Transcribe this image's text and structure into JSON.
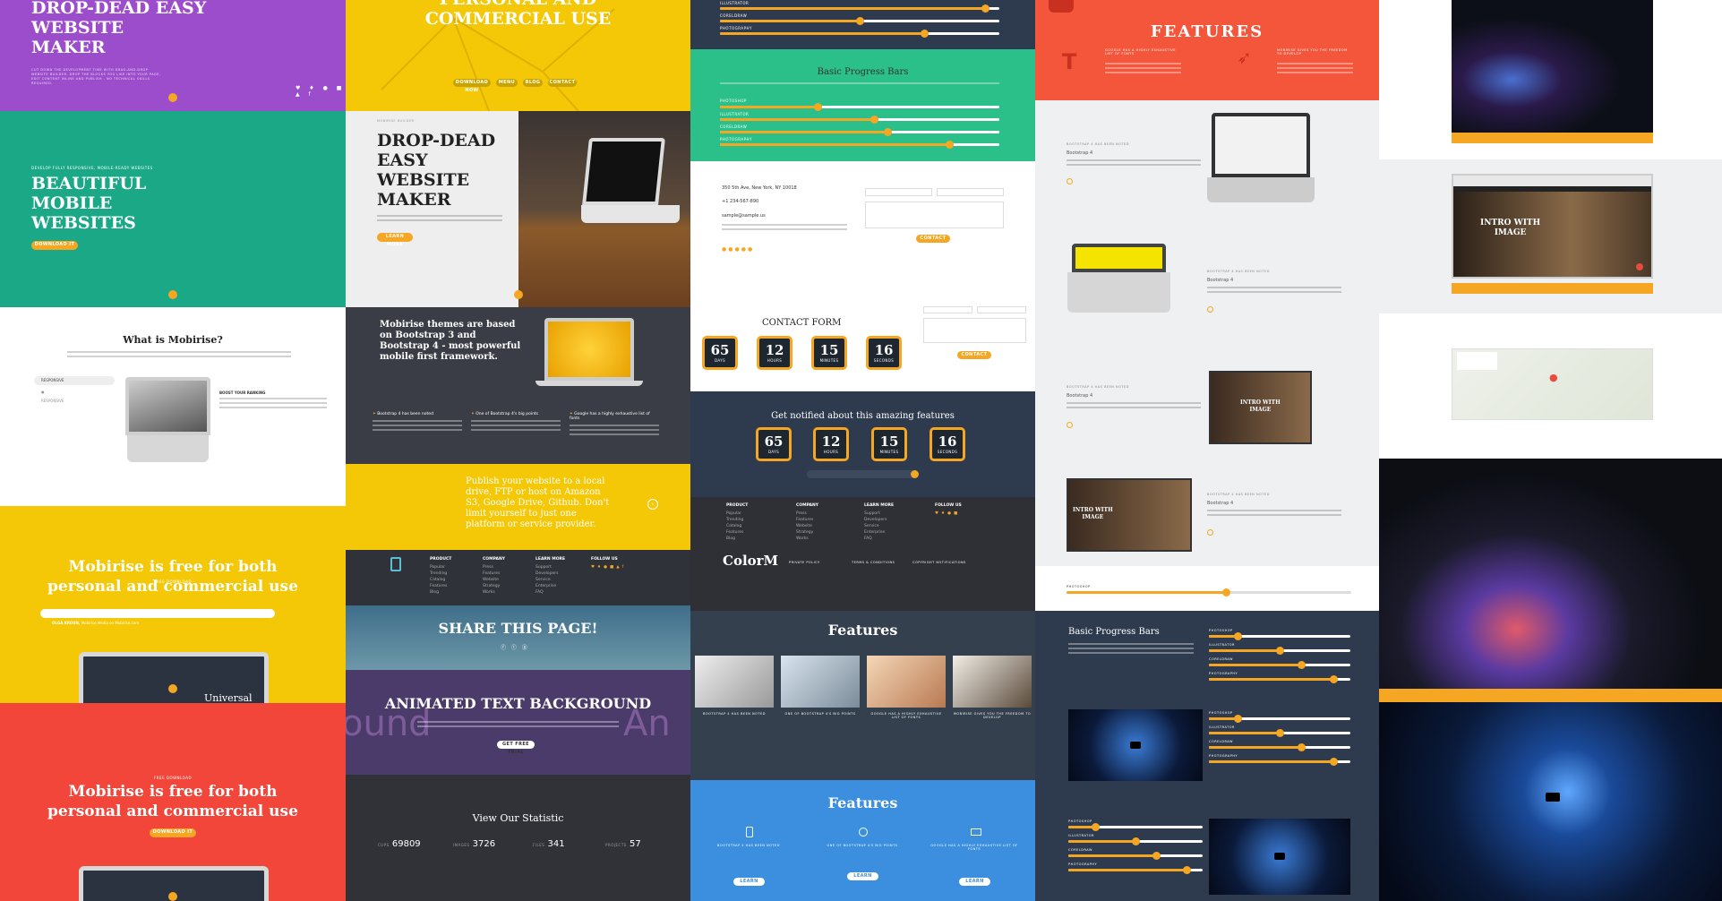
{
  "colors": {
    "accent": "#f5a623",
    "purple": "#9c4dcc",
    "teal": "#1aa886",
    "yellow": "#f4c807",
    "red": "#f2463a",
    "navy": "#2e3b4e",
    "darkgrey": "#3a3d45",
    "green": "#2bbf8a",
    "blue": "#3b8fde",
    "orange": "#f4563b",
    "lightgrey": "#eff0f2"
  },
  "c1": {
    "hero_title": "DROP-DEAD EASY\nWEBSITE\nMAKER",
    "hero_sub": "CUT DOWN THE DEVELOPMENT TIME WITH DRAG-AND-DROP WEBSITE BUILDER. DROP THE BLOCKS YOU LIKE INTO YOUR PAGE, EDIT CONTENT INLINE AND PUBLISH - NO TECHNICAL SKILLS REQUIRED.",
    "teal_kicker": "DEVELOP FULLY RESPONSIVE, MOBILE-READY WEBSITES",
    "teal_title": "BEAUTIFUL\nMOBILE\nWEBSITES",
    "teal_btn": "DOWNLOAD IT",
    "what_title": "What is Mobirise?",
    "tabs": [
      "RESPONSIVE",
      "",
      "RESPONSIVE"
    ],
    "boost": "BOOST YOUR RANKING",
    "free_kicker": "FREE DOWNLOAD",
    "free_title": "Mobirise is free for both\npersonal and commercial use",
    "testimonial_name": "OLGA KROUN,",
    "testimonial_role": "Mobirise Media on Mobirise.com",
    "universal": "Universal",
    "free_kicker2": "FREE DOWNLOAD",
    "free_title2": "Mobirise is free for both\npersonal and commercial use",
    "free_btn2": "DOWNLOAD IT"
  },
  "c2": {
    "top_title": "PERSONAL AND\nCOMMERCIAL USE",
    "top_btns": [
      "DOWNLOAD NOW",
      "MENU",
      "BLOG",
      "CONTACT"
    ],
    "hero_kicker": "MOBIRISE BUILDER",
    "hero_title": "DROP-DEAD\nEASY\nWEBSITE\nMAKER",
    "hero_btn": "LEARN MORE",
    "themes_title": "Mobirise themes are based\non Bootstrap 3 and\nBootstrap 4 - most powerful\nmobile first framework.",
    "feat": [
      "Bootstrap 4 has been noted",
      "One of Bootstrap 4's big points",
      "Google has a highly exhaustive list of fonts"
    ],
    "publish": "Publish your website to a local\ndrive, FTP or host on Amazon\nS3, Google Drive, Github. Don't\nlimit yourself to just one\nplatform or service provider.",
    "foot_cols": [
      {
        "h": "PRODUCT",
        "items": [
          "Popular",
          "Trending",
          "Catalog",
          "Features",
          "Blog"
        ]
      },
      {
        "h": "COMPANY",
        "items": [
          "Press",
          "Features",
          "Website",
          "Strategy",
          "Works"
        ]
      },
      {
        "h": "LEARN MORE",
        "items": [
          "Support",
          "Developers",
          "Service",
          "Enterprise",
          "FAQ"
        ]
      },
      {
        "h": "FOLLOW US",
        "items": []
      }
    ],
    "share": "SHARE THIS PAGE!",
    "animated": "ANIMATED TEXT BACKGROUND",
    "animated_bg_left": "ound",
    "animated_bg_right": "An",
    "animated_btn": "GET FREE TRIAL",
    "stats_title": "View Our Statistic",
    "stats": [
      {
        "label": "CUPS",
        "value": "69809"
      },
      {
        "label": "IMAGES",
        "value": "3726"
      },
      {
        "label": "FILES",
        "value": "341"
      },
      {
        "label": "PROJECTS",
        "value": "57"
      }
    ]
  },
  "c3": {
    "bars_labels": [
      "ILLUSTRATOR",
      "CORELDRAW",
      "PHOTOGRAPHY"
    ],
    "bars_values": [
      0.95,
      0.5,
      0.73
    ],
    "basic_title": "Basic Progress Bars",
    "green_labels": [
      "PHOTOSHOP",
      "ILLUSTRATOR",
      "CORELDRAW",
      "PHOTOGRAPHY"
    ],
    "green_values": [
      0.35,
      0.55,
      0.6,
      0.82
    ],
    "address": "350 5th Ave, New York, NY 10018",
    "phone": "+1 234-567-890",
    "email": "sample@sample.us",
    "contact_btn": "CONTACT US",
    "form_title": "CONTACT FORM",
    "countdown": [
      {
        "v": "65",
        "l": "DAYS"
      },
      {
        "v": "12",
        "l": "HOURS"
      },
      {
        "v": "15",
        "l": "MINUTES"
      },
      {
        "v": "16",
        "l": "SECONDS"
      }
    ],
    "notify": "Get notified about this amazing features",
    "foot_cols": [
      {
        "h": "PRODUCT",
        "items": [
          "Popular",
          "Trending",
          "Catalog",
          "Features",
          "Blog"
        ]
      },
      {
        "h": "COMPANY",
        "items": [
          "Press",
          "Features",
          "Website",
          "Strategy",
          "Works"
        ]
      },
      {
        "h": "LEARN MORE",
        "items": [
          "Support",
          "Developers",
          "Service",
          "Enterprise",
          "FAQ"
        ]
      },
      {
        "h": "FOLLOW US",
        "items": []
      }
    ],
    "logo": "ColorM",
    "links": [
      "PRIVATE POLICY",
      "TERMS & CONDITIONS",
      "COPYRIGHT NOTIFICATIONS"
    ],
    "feat_title": "Features",
    "feat_items": [
      "BOOTSTRAP 4 HAS BEEN NOTED",
      "ONE OF BOOTSTRAP 4'S BIG POINTS",
      "GOOGLE HAS A HIGHLY EXHAUSTIVE LIST OF FONTS",
      "MOBIRISE GIVES YOU THE FREEDOM TO DEVELOP"
    ],
    "feat2_title": "Features",
    "feat2_items": [
      "BOOTSTRAP 4 HAS BEEN NOTED",
      "ONE OF BOOTSTRAP 4'S BIG POINTS",
      "GOOGLE HAS A HIGHLY EXHAUSTIVE LIST OF FONTS"
    ],
    "learn": "LEARN MORE"
  },
  "c4": {
    "feat_title": "FEATURES",
    "feat_a": "GOOGLE HAS A HIGHLY EXHAUSTIVE LIST OF FONTS",
    "feat_b": "MOBIRISE GIVES YOU THE FREEDOM TO DEVELOP",
    "items": [
      {
        "k": "BOOTSTRAP 4 HAS BEEN NOTED",
        "t": "Bootstrap 4"
      },
      {
        "k": "BOOTSTRAP 4 HAS BEEN NOTED",
        "t": "Bootstrap 4"
      },
      {
        "k": "BOOTSTRAP 4 HAS BEEN NOTED",
        "t": "Bootstrap 4"
      },
      {
        "k": "BOOTSTRAP 4 HAS BEEN NOTED",
        "t": "Bootstrap 4"
      }
    ],
    "intro": "INTRO WITH\nIMAGE",
    "photoshop": "PHOTOSHOP",
    "photoshop_value": 0.56,
    "basic_title": "Basic Progress Bars",
    "bar_labels": [
      "PHOTOSHOP",
      "ILLUSTRATOR",
      "CORELDRAW",
      "PHOTOGRAPHY"
    ],
    "bar_values": [
      0.2,
      0.5,
      0.65,
      0.88
    ]
  },
  "c5": {
    "intro": "INTRO WITH\nIMAGE"
  }
}
